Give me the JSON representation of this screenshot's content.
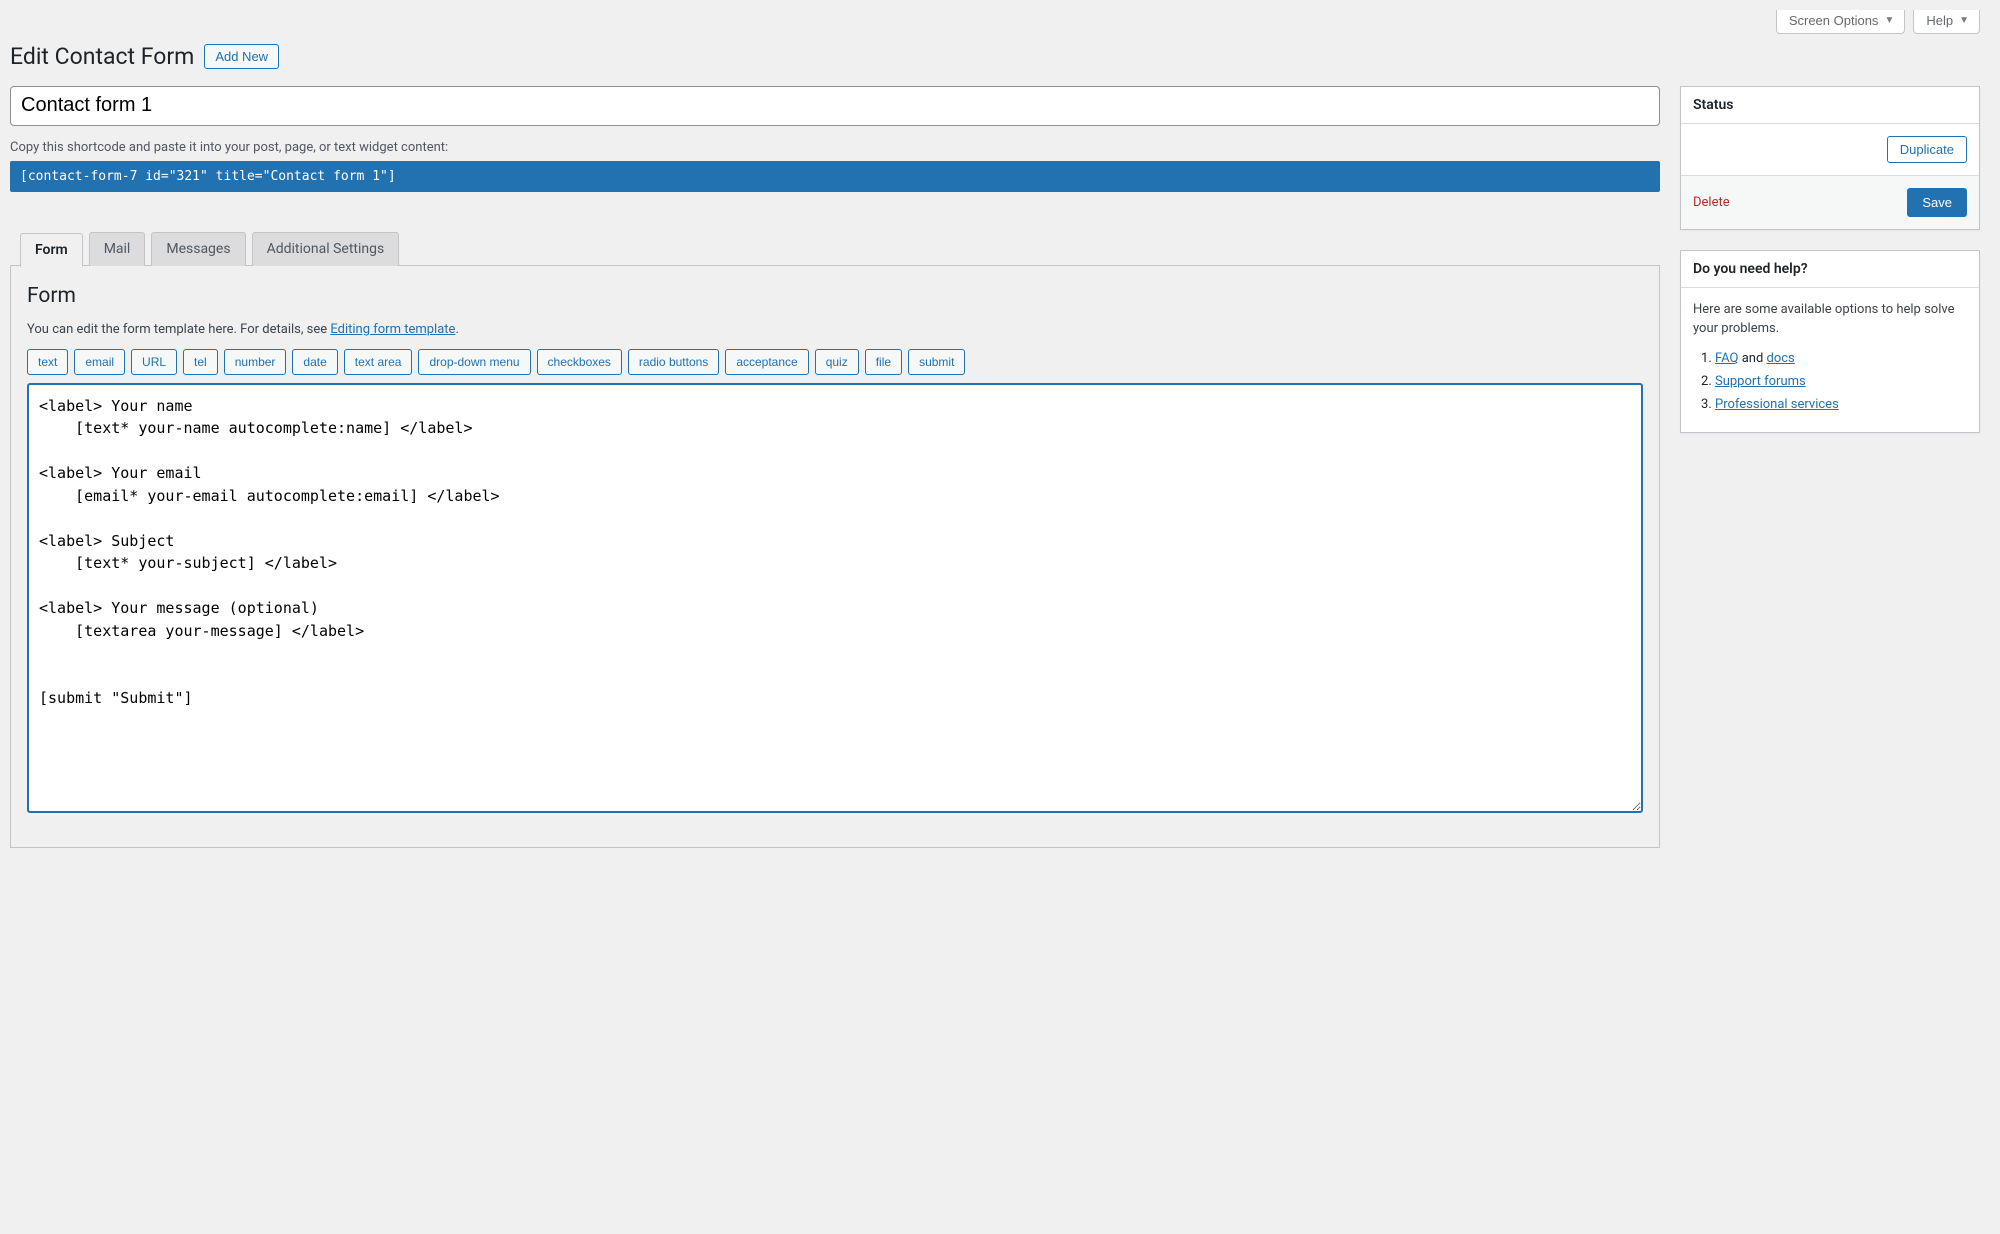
{
  "topbar": {
    "screen_options": "Screen Options",
    "help": "Help"
  },
  "header": {
    "page_title": "Edit Contact Form",
    "add_new": "Add New"
  },
  "form_title": "Contact form 1",
  "shortcode": {
    "description": "Copy this shortcode and paste it into your post, page, or text widget content:",
    "value": "[contact-form-7 id=\"321\" title=\"Contact form 1\"]"
  },
  "tabs": {
    "form": "Form",
    "mail": "Mail",
    "messages": "Messages",
    "additional": "Additional Settings"
  },
  "form_panel": {
    "heading": "Form",
    "desc_prefix": "You can edit the form template here. For details, see ",
    "desc_link": "Editing form template",
    "desc_suffix": ".",
    "tag_buttons": [
      "text",
      "email",
      "URL",
      "tel",
      "number",
      "date",
      "text area",
      "drop-down menu",
      "checkboxes",
      "radio buttons",
      "acceptance",
      "quiz",
      "file",
      "submit"
    ],
    "template": "<label> Your name\n    [text* your-name autocomplete:name] </label>\n\n<label> Your email\n    [email* your-email autocomplete:email] </label>\n\n<label> Subject\n    [text* your-subject] </label>\n\n<label> Your message (optional)\n    [textarea your-message] </label>\n\n\n[submit \"Submit\"]"
  },
  "sidebar": {
    "status": {
      "title": "Status",
      "duplicate": "Duplicate",
      "delete": "Delete",
      "save": "Save"
    },
    "help": {
      "title": "Do you need help?",
      "intro": "Here are some available options to help solve your problems.",
      "item1_a": "FAQ",
      "item1_mid": " and ",
      "item1_b": "docs",
      "item2": "Support forums",
      "item3": "Professional services"
    }
  }
}
